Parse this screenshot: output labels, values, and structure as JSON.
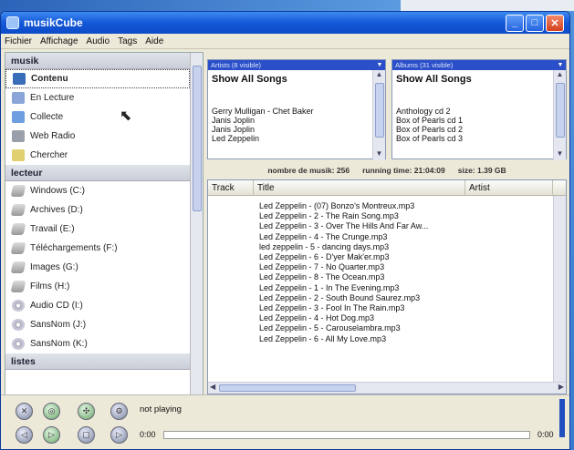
{
  "window": {
    "title": "musikCube"
  },
  "menu": [
    "Fichier",
    "Affichage",
    "Audio",
    "Tags",
    "Aide"
  ],
  "sidebar": {
    "sections": [
      {
        "label": "musik"
      },
      {
        "label": "lecteur"
      },
      {
        "label": "listes"
      }
    ],
    "musik_items": [
      {
        "label": "Contenu",
        "icon": "content-icon",
        "selected": true
      },
      {
        "label": "En Lecture",
        "icon": "now-playing-icon"
      },
      {
        "label": "Collecte",
        "icon": "collect-icon"
      },
      {
        "label": "Web Radio",
        "icon": "radio-icon"
      },
      {
        "label": "Chercher",
        "icon": "search-icon"
      }
    ],
    "lecteur_items": [
      {
        "label": "Windows (C:)",
        "icon": "drive-icon"
      },
      {
        "label": "Archives (D:)",
        "icon": "drive-icon"
      },
      {
        "label": "Travail (E:)",
        "icon": "drive-icon"
      },
      {
        "label": "Téléchargements (F:)",
        "icon": "drive-icon"
      },
      {
        "label": "Images (G:)",
        "icon": "drive-icon"
      },
      {
        "label": "Films (H:)",
        "icon": "drive-icon"
      },
      {
        "label": "Audio CD (I:)",
        "icon": "cd-icon"
      },
      {
        "label": "SansNom (J:)",
        "icon": "cd-icon"
      },
      {
        "label": "SansNom (K:)",
        "icon": "cd-icon"
      }
    ]
  },
  "artists": {
    "header": "Artists (8 visible)",
    "show_all": "Show All Songs",
    "items": [
      "Gerry Mulligan - Chet Baker",
      "Janis Joplin",
      "Janis Joplin",
      "Led Zeppelin"
    ]
  },
  "albums": {
    "header": "Albums (31 visible)",
    "show_all": "Show All Songs",
    "items": [
      "Anthology cd 2",
      "Box of Pearls cd 1",
      "Box of Pearls cd 2",
      "Box of Pearls cd 3"
    ]
  },
  "status": {
    "count": "nombre de musik: 256",
    "running": "running time: 21:04:09",
    "size": "size: 1.39 GB"
  },
  "tracklist": {
    "columns": {
      "track": "Track",
      "title": "Title",
      "artist": "Artist"
    },
    "rows": [
      "Led Zeppelin - (07) Bonzo's Montreux.mp3",
      "Led Zeppelin - 2 - The Rain Song.mp3",
      "Led Zeppelin - 3 - Over The Hills And Far Aw...",
      "Led Zeppelin - 4 - The Crunge.mp3",
      "led zeppelin - 5 - dancing days.mp3",
      "Led Zeppelin - 6 - D'yer Mak'er.mp3",
      "Led Zeppelin - 7 - No Quarter.mp3",
      "Led Zeppelin - 8 - The Ocean.mp3",
      "Led Zeppelin - 1 - In The Evening.mp3",
      "Led Zeppelin - 2 - South Bound Saurez.mp3",
      "Led Zeppelin - 3 - Fool In The Rain.mp3",
      "Led Zeppelin - 4 - Hot Dog.mp3",
      "Led Zeppelin - 5 - Carouselambra.mp3",
      "Led Zeppelin - 6 - All My Love.mp3"
    ]
  },
  "player": {
    "status": "not playing",
    "time_left": "0:00",
    "time_right": "0:00",
    "progress": 0
  },
  "colors": {
    "accent": "#2a4fc8",
    "titlebar": "#1458d8",
    "close": "#d4401e"
  }
}
